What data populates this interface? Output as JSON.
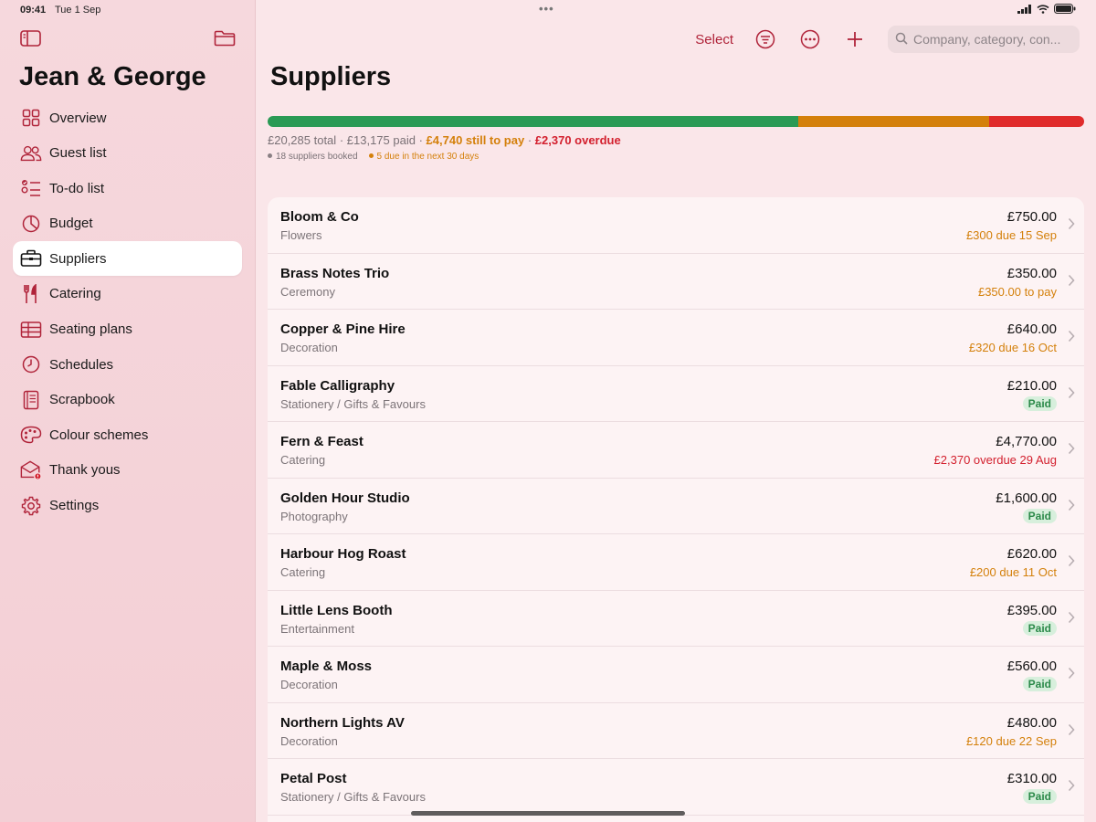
{
  "statusbar": {
    "time": "09:41",
    "date": "Tue 1 Sep"
  },
  "sidebar": {
    "title": "Jean & George",
    "items": [
      {
        "label": "Overview",
        "icon": "grid-icon",
        "active": false
      },
      {
        "label": "Guest list",
        "icon": "people-icon",
        "active": false
      },
      {
        "label": "To-do list",
        "icon": "checklist-icon",
        "active": false
      },
      {
        "label": "Budget",
        "icon": "pie-chart-icon",
        "active": false
      },
      {
        "label": "Suppliers",
        "icon": "briefcase-icon",
        "active": true
      },
      {
        "label": "Catering",
        "icon": "fork-knife-icon",
        "active": false
      },
      {
        "label": "Seating plans",
        "icon": "table-icon",
        "active": false
      },
      {
        "label": "Schedules",
        "icon": "clock-icon",
        "active": false
      },
      {
        "label": "Scrapbook",
        "icon": "book-icon",
        "active": false
      },
      {
        "label": "Colour schemes",
        "icon": "palette-icon",
        "active": false
      },
      {
        "label": "Thank yous",
        "icon": "envelope-icon",
        "active": false
      },
      {
        "label": "Settings",
        "icon": "gear-icon",
        "active": false
      }
    ]
  },
  "toolbar": {
    "select_label": "Select",
    "search_placeholder": "Company, category, con..."
  },
  "page": {
    "title": "Suppliers",
    "summary": {
      "total": "£20,285 total",
      "paid": "£13,175 paid",
      "to_pay": "£4,740 still to pay",
      "overdue": "£2,370 overdue",
      "booked": "18 suppliers booked",
      "due_soon": "5 due in the next 30 days"
    },
    "progress": {
      "paid": 13175,
      "to_pay": 4740,
      "overdue": 2370
    }
  },
  "colors": {
    "accent": "#b0243a",
    "paid": "#2a9a55",
    "due": "#d4800b",
    "overdue": "#e02b2b"
  },
  "suppliers": [
    {
      "name": "Bloom & Co",
      "category": "Flowers",
      "amount": "£750.00",
      "status": "£300 due 15 Sep",
      "status_type": "due"
    },
    {
      "name": "Brass Notes Trio",
      "category": "Ceremony",
      "amount": "£350.00",
      "status": "£350.00 to pay",
      "status_type": "due"
    },
    {
      "name": "Copper & Pine Hire",
      "category": "Decoration",
      "amount": "£640.00",
      "status": "£320 due 16 Oct",
      "status_type": "due"
    },
    {
      "name": "Fable Calligraphy",
      "category": "Stationery / Gifts & Favours",
      "amount": "£210.00",
      "status": "Paid",
      "status_type": "paid"
    },
    {
      "name": "Fern & Feast",
      "category": "Catering",
      "amount": "£4,770.00",
      "status": "£2,370 overdue 29 Aug",
      "status_type": "overdue"
    },
    {
      "name": "Golden Hour Studio",
      "category": "Photography",
      "amount": "£1,600.00",
      "status": "Paid",
      "status_type": "paid"
    },
    {
      "name": "Harbour Hog Roast",
      "category": "Catering",
      "amount": "£620.00",
      "status": "£200 due 11 Oct",
      "status_type": "due"
    },
    {
      "name": "Little Lens Booth",
      "category": "Entertainment",
      "amount": "£395.00",
      "status": "Paid",
      "status_type": "paid"
    },
    {
      "name": "Maple & Moss",
      "category": "Decoration",
      "amount": "£560.00",
      "status": "Paid",
      "status_type": "paid"
    },
    {
      "name": "Northern Lights AV",
      "category": "Decoration",
      "amount": "£480.00",
      "status": "£120 due 22 Sep",
      "status_type": "due"
    },
    {
      "name": "Petal Post",
      "category": "Stationery / Gifts & Favours",
      "amount": "£310.00",
      "status": "Paid",
      "status_type": "paid"
    }
  ]
}
